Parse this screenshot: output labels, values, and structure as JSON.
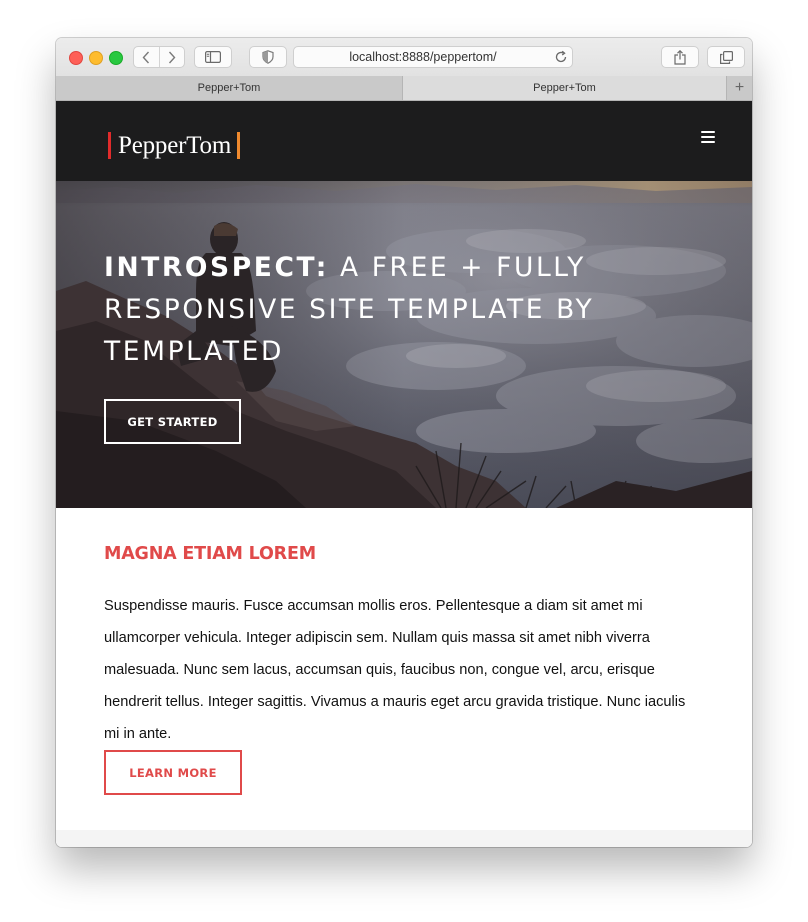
{
  "browser": {
    "url": "localhost:8888/peppertom/",
    "tabs": [
      {
        "label": "Pepper+Tom"
      },
      {
        "label": "Pepper+Tom"
      }
    ],
    "new_tab_symbol": "+"
  },
  "site": {
    "logo_text": "PepperTom",
    "brand_colors": {
      "bar_left": "#e12b2b",
      "bar_right": "#f08a2e",
      "accent": "#e04a4a",
      "header_bg": "#1c1c1d"
    },
    "hero": {
      "title_strong": "Introspect:",
      "title_rest": " A free + fully responsive site template by TEMPLATED",
      "button_label": "Get Started"
    },
    "section": {
      "heading": "Magna Etiam Lorem",
      "body": "Suspendisse mauris. Fusce accumsan mollis eros. Pellentesque a diam sit amet mi ullamcorper vehicula. Integer adipiscin sem. Nullam quis massa sit amet nibh viverra malesuada. Nunc sem lacus, accumsan quis, faucibus non, congue vel, arcu, erisque hendrerit tellus. Integer sagittis. Vivamus a mauris eget arcu gravida tristique. Nunc iaculis mi in ante.",
      "button_label": "Learn More"
    }
  },
  "icons": {
    "back": "chevron-left-icon",
    "forward": "chevron-right-icon",
    "sidebar": "sidebar-icon",
    "privacy": "shield-icon",
    "reload": "reload-icon",
    "share": "share-icon",
    "tabs": "tabs-overview-icon",
    "menu": "hamburger-menu-icon"
  }
}
